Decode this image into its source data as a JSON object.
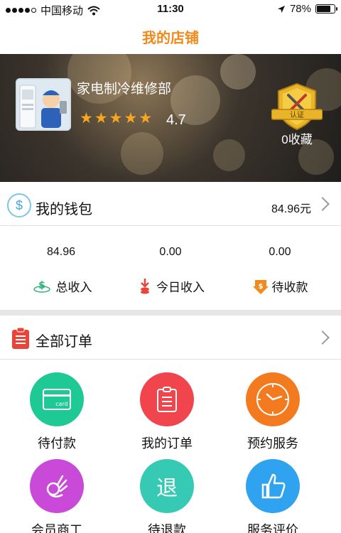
{
  "status_bar": {
    "carrier": "中国移动",
    "time": "11:30",
    "battery": "78%",
    "battery_level": 0.78
  },
  "nav": {
    "title": "我的店铺"
  },
  "shop": {
    "name": "家电制冷维修部",
    "stars": 5,
    "rating": "4.7",
    "badge_text": "认证",
    "favorites": "0收藏"
  },
  "wallet": {
    "label": "我的钱包",
    "amount": "84.96元"
  },
  "stats": [
    {
      "value": "84.96",
      "label": "总收入",
      "icon": "income-icon"
    },
    {
      "value": "0.00",
      "label": "今日收入",
      "icon": "today-income-icon"
    },
    {
      "value": "0.00",
      "label": "待收款",
      "icon": "pending-icon"
    }
  ],
  "orders": {
    "label": "全部订单"
  },
  "order_items": [
    {
      "label": "待付款",
      "icon": "card-icon",
      "color": "#1fc995",
      "icon_text": "card"
    },
    {
      "label": "我的订单",
      "icon": "clipboard-icon",
      "color": "#f0454d"
    },
    {
      "label": "预约服务",
      "icon": "clock-icon",
      "color": "#f47a1f"
    },
    {
      "label": "会员商工",
      "icon": "ok-hand-icon",
      "color": "#c94ad8"
    },
    {
      "label": "待退款",
      "icon": "refund-icon",
      "color": "#36c9b4",
      "icon_text": "退"
    },
    {
      "label": "服务评价",
      "icon": "thumbs-up-icon",
      "color": "#2fa3f0"
    }
  ],
  "colors": {
    "accent": "#f08a1c",
    "star": "#f6a623"
  }
}
